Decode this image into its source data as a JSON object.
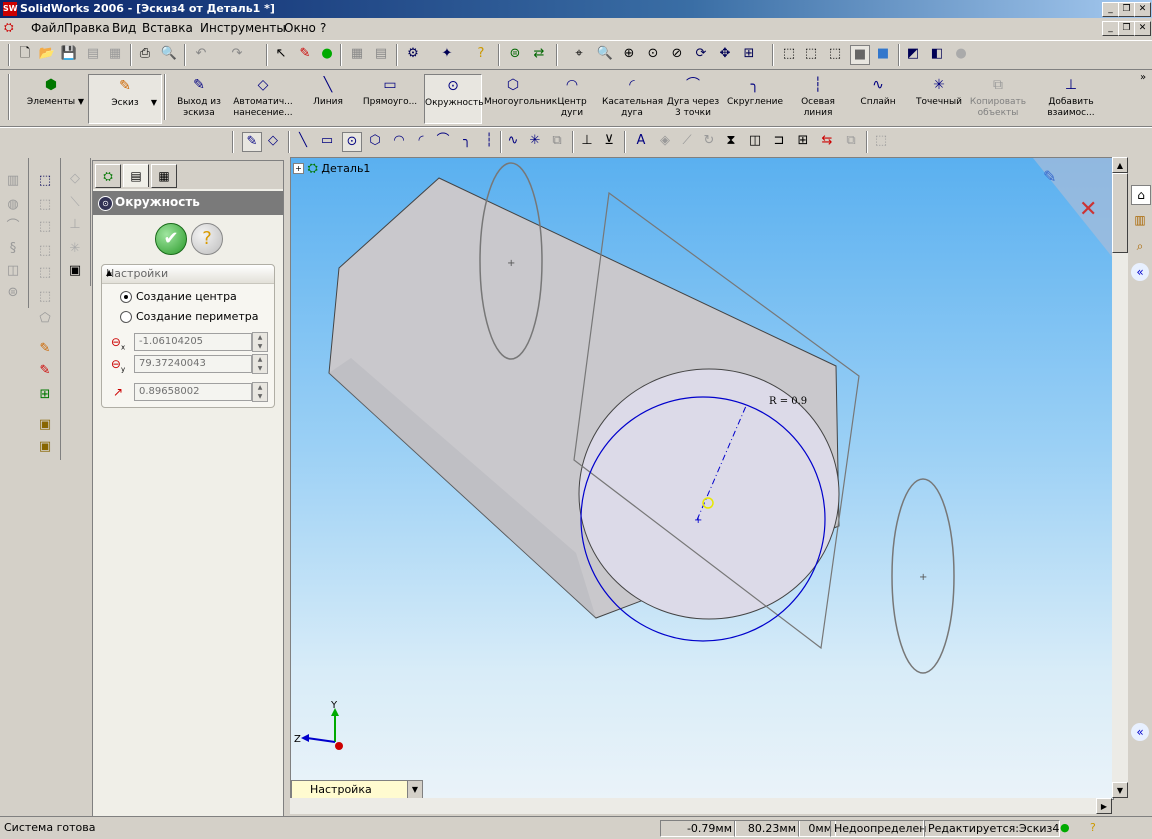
{
  "window": {
    "title": "SolidWorks 2006 - [Эскиз4 от Деталь1 *]",
    "controls": [
      "_",
      "❐",
      "✕"
    ]
  },
  "menu": [
    "Файл",
    "Правка",
    "Вид",
    "Вставка",
    "Инструменты",
    "Окно",
    "?"
  ],
  "command_manager": {
    "elements": "Элементы",
    "sketch": "Эскиз",
    "buttons": [
      {
        "label": "Выход из эскиза",
        "icon": "exit-sketch-icon",
        "glyph": "✎"
      },
      {
        "label": "Автоматич... нанесение...",
        "icon": "smart-dimension-icon",
        "glyph": "◇"
      },
      {
        "label": "Линия",
        "icon": "line-icon",
        "glyph": "╲"
      },
      {
        "label": "Прямоуго...",
        "icon": "rectangle-icon",
        "glyph": "▭"
      },
      {
        "label": "Окружность",
        "icon": "circle-icon",
        "glyph": "⊙",
        "pressed": true
      },
      {
        "label": "Многоугольник",
        "icon": "polygon-icon",
        "glyph": "⬡"
      },
      {
        "label": "Центр дуги",
        "icon": "centerpoint-arc-icon",
        "glyph": "◠"
      },
      {
        "label": "Касательная дуга",
        "icon": "tangent-arc-icon",
        "glyph": "◜"
      },
      {
        "label": "Дуга через 3 точки",
        "icon": "three-point-arc-icon",
        "glyph": "⌒"
      },
      {
        "label": "Скругление",
        "icon": "fillet-icon",
        "glyph": "╮"
      },
      {
        "label": "Осевая линия",
        "icon": "centerline-icon",
        "glyph": "┆"
      },
      {
        "label": "Сплайн",
        "icon": "spline-icon",
        "glyph": "∿"
      },
      {
        "label": "Точечный",
        "icon": "point-icon",
        "glyph": "✳"
      },
      {
        "label": "Копировать объекты",
        "icon": "copy-entities-icon",
        "glyph": "⧉",
        "disabled": true
      },
      {
        "label": "Добавить взаимос...",
        "icon": "add-relation-icon",
        "glyph": "⊥"
      }
    ]
  },
  "property_manager": {
    "title": "Окружность",
    "group_title": "Настройки",
    "options": [
      "Создание центра",
      "Создание периметра"
    ],
    "selected_option": 0,
    "center_x": "-1.06104205",
    "center_y": "79.37240043",
    "radius": "0.89658002"
  },
  "graphics": {
    "tree_root": "Деталь1",
    "radius_label": "R = 0.9",
    "axis_labels": {
      "x": "Z",
      "y": "Y"
    }
  },
  "config_dropdown": "Настройка",
  "status": {
    "message": "Система готова",
    "x": "-0.79мм",
    "y": "80.23мм",
    "z": "0мм",
    "state": "Недоопределен",
    "editing": "Редактируется:Эскиз4"
  },
  "colors": {
    "sketch_blue": "#0000cc",
    "part_gray": "#c9c8cc",
    "face_light": "#dcdae8",
    "title_bar": "#0a246a"
  }
}
